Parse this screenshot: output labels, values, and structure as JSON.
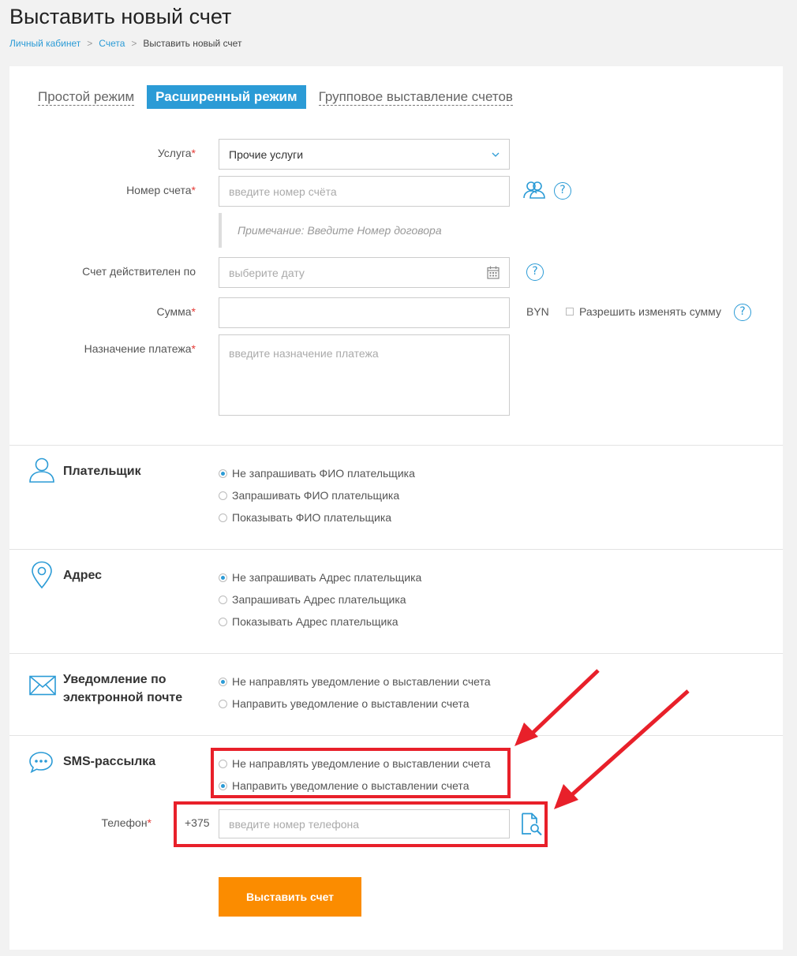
{
  "page": {
    "title": "Выставить новый счет",
    "breadcrumb": [
      "Личный кабинет",
      "Счета",
      "Выставить новый счет"
    ],
    "breadcrumb_sep": ">"
  },
  "tabs": [
    {
      "label": "Простой режим",
      "active": false
    },
    {
      "label": "Расширенный режим",
      "active": true
    },
    {
      "label": "Групповое выставление счетов",
      "active": false
    }
  ],
  "form": {
    "service": {
      "label": "Услуга",
      "value": "Прочие услуги"
    },
    "account": {
      "label": "Номер счета",
      "placeholder": "введите номер счёта"
    },
    "note": "Примечание: Введите Номер договора",
    "valid_until": {
      "label": "Счет действителен по",
      "placeholder": "выберите дату"
    },
    "amount": {
      "label": "Сумма",
      "currency": "BYN",
      "allow_change": "Разрешить изменять сумму"
    },
    "purpose": {
      "label": "Назначение платежа",
      "placeholder": "введите назначение платежа"
    },
    "required_mark": "*",
    "help_mark": "?"
  },
  "sections": {
    "payer": {
      "title": "Плательщик",
      "options": [
        "Не запрашивать ФИО плательщика",
        "Запрашивать ФИО плательщика",
        "Показывать ФИО плательщика"
      ],
      "selected": 0
    },
    "address": {
      "title": "Адрес",
      "options": [
        "Не запрашивать Адрес плательщика",
        "Запрашивать Адрес плательщика",
        "Показывать Адрес плательщика"
      ],
      "selected": 0
    },
    "email": {
      "title_line1": "Уведомление по",
      "title_line2": "электронной почте",
      "options": [
        "Не направлять уведомление о выставлении счета",
        "Направить уведомление о выставлении счета"
      ],
      "selected": 0
    },
    "sms": {
      "title": "SMS-рассылка",
      "options": [
        "Не направлять уведомление о выставлении счета",
        "Направить уведомление о выставлении счета"
      ],
      "selected": 1,
      "phone_label": "Телефон",
      "phone_prefix": "+375",
      "phone_placeholder": "введите номер телефона"
    }
  },
  "submit_label": "Выставить счет",
  "colors": {
    "accent": "#2b9bd6",
    "submit": "#fb8c00",
    "highlight": "#e8202a"
  }
}
